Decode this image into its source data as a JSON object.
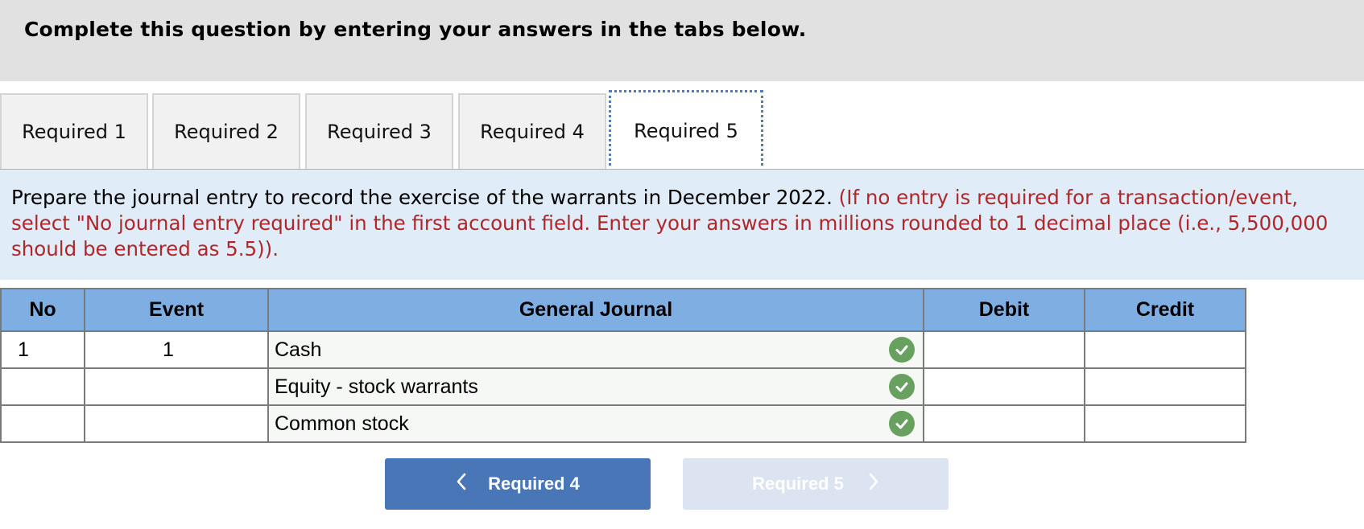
{
  "header": {
    "title": "Complete this question by entering your answers in the tabs below."
  },
  "tabs": [
    {
      "label": "Required 1",
      "active": false
    },
    {
      "label": "Required 2",
      "active": false
    },
    {
      "label": "Required 3",
      "active": false
    },
    {
      "label": "Required 4",
      "active": false
    },
    {
      "label": "Required 5",
      "active": true
    }
  ],
  "instructions": {
    "main": "Prepare the journal entry to record the exercise of the warrants in December 2022.",
    "note": "(If no entry is required for a transaction/event, select \"No journal entry required\" in the first account field. Enter your answers in millions rounded to 1 decimal place (i.e., 5,500,000 should be entered as 5.5))."
  },
  "journal": {
    "headers": {
      "no": "No",
      "event": "Event",
      "general_journal": "General Journal",
      "debit": "Debit",
      "credit": "Credit"
    },
    "rows": [
      {
        "no": "1",
        "event": "1",
        "account": "Cash",
        "debit": "",
        "credit": "",
        "check": "check-icon"
      },
      {
        "no": "",
        "event": "",
        "account": "Equity - stock warrants",
        "debit": "",
        "credit": "",
        "check": "check-icon"
      },
      {
        "no": "",
        "event": "",
        "account": "Common stock",
        "debit": "",
        "credit": "",
        "check": "check-icon"
      }
    ]
  },
  "nav": {
    "prev_label": "Required 4",
    "prev_icon": "chevron-left-icon",
    "next_label": "Required 5",
    "next_icon": "chevron-right-icon"
  },
  "colors": {
    "header_bg": "#e1e1e1",
    "instructions_bg": "#e0ecf8",
    "note_red": "#b0272b",
    "table_header": "#7faee2",
    "check_green": "#67a05f",
    "button_blue": "#4876b7",
    "button_disabled": "#dbe4f0"
  }
}
